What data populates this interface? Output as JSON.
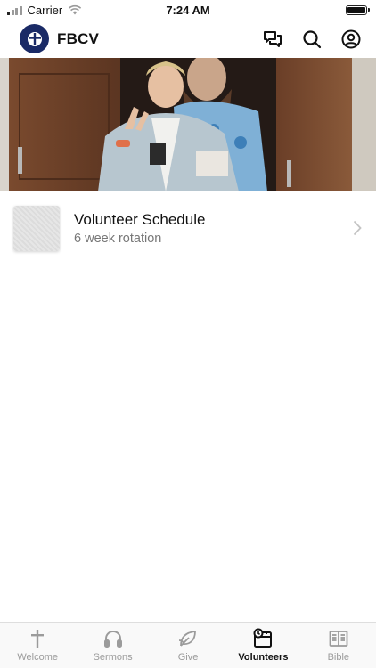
{
  "status_bar": {
    "carrier": "Carrier",
    "time": "7:24 AM"
  },
  "header": {
    "title": "FBCV",
    "icons": [
      "chat-icon",
      "search-icon",
      "profile-icon"
    ]
  },
  "hero": {
    "description_icon": "hero-photo"
  },
  "list": {
    "items": [
      {
        "title": "Volunteer Schedule",
        "subtitle": "6 week rotation"
      }
    ]
  },
  "tabs": [
    {
      "label": "Welcome",
      "icon": "cross-icon",
      "active": false
    },
    {
      "label": "Sermons",
      "icon": "headphones-icon",
      "active": false
    },
    {
      "label": "Give",
      "icon": "leaf-icon",
      "active": false
    },
    {
      "label": "Volunteers",
      "icon": "calendar-clock-icon",
      "active": true
    },
    {
      "label": "Bible",
      "icon": "book-icon",
      "active": false
    }
  ],
  "colors": {
    "brand": "#1a2a66",
    "tab_inactive": "#9b9b9b",
    "tab_active": "#111111"
  }
}
